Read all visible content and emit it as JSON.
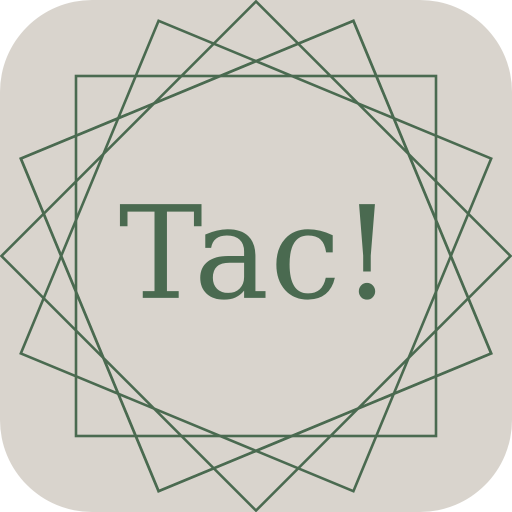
{
  "app_icon": {
    "wordmark": "Tac!",
    "background_color": "#d9d4cd",
    "accent_color": "#4a6a50",
    "ornament": "star-of-rotated-squares-icon"
  }
}
